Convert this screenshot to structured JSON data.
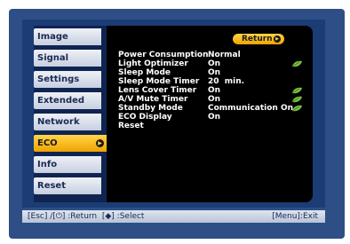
{
  "menu": {
    "items": [
      {
        "label": "Image",
        "active": false
      },
      {
        "label": "Signal",
        "active": false
      },
      {
        "label": "Settings",
        "active": false
      },
      {
        "label": "Extended",
        "active": false
      },
      {
        "label": "Network",
        "active": false
      },
      {
        "label": "ECO",
        "active": true
      },
      {
        "label": "Info",
        "active": false
      },
      {
        "label": "Reset",
        "active": false
      }
    ]
  },
  "return_label": "Return",
  "settings": [
    {
      "label": "Power Consumption",
      "value": "Normal",
      "eco_leaf": false
    },
    {
      "label": "Light Optimizer",
      "value": "On",
      "eco_leaf": true
    },
    {
      "label": "Sleep Mode",
      "value": "On",
      "eco_leaf": false
    },
    {
      "label": "Sleep Mode Timer",
      "value": "20  min.",
      "eco_leaf": false
    },
    {
      "label": "Lens Cover Timer",
      "value": "On",
      "eco_leaf": true
    },
    {
      "label": "A/V Mute Timer",
      "value": "On",
      "eco_leaf": true
    },
    {
      "label": "Standby Mode",
      "value": "Communication On",
      "eco_leaf": true
    },
    {
      "label": "ECO Display",
      "value": "On",
      "eco_leaf": false
    },
    {
      "label": "Reset",
      "value": "",
      "eco_leaf": false
    }
  ],
  "status_bar": {
    "left": "[Esc] /[⏻] :Return  [◆] :Select",
    "right": "[Menu]:Exit"
  },
  "colors": {
    "accent": "#f0a300",
    "leaf": "#7cc13f",
    "background": "#2d4f86"
  }
}
